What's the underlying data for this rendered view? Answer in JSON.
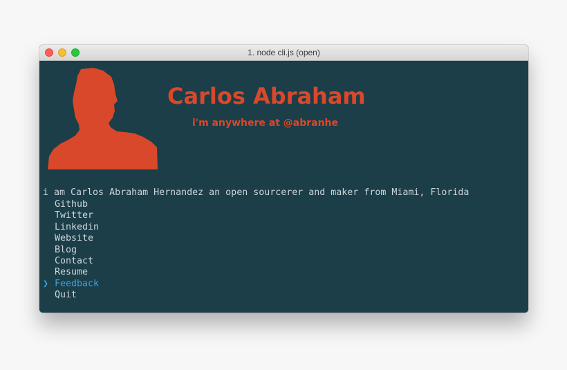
{
  "window": {
    "title": "1. node cli.js (open)"
  },
  "profile": {
    "name": "Carlos Abraham",
    "handle": "i'm anywhere at @abranhe",
    "bio": "i am Carlos Abraham Hernandez an open sourcerer and maker from Miami, Florida",
    "avatar_color": "#d9482a"
  },
  "menu": {
    "pointer": "❯",
    "selected_index": 7,
    "items": [
      {
        "label": "Github"
      },
      {
        "label": "Twitter"
      },
      {
        "label": "Linkedin"
      },
      {
        "label": "Website"
      },
      {
        "label": "Blog"
      },
      {
        "label": "Contact"
      },
      {
        "label": "Resume"
      },
      {
        "label": "Feedback"
      },
      {
        "label": "Quit"
      }
    ]
  },
  "colors": {
    "terminal_bg": "#1b3e49",
    "accent": "#d9482a",
    "selection": "#3fa3dc",
    "text": "#cdd6d9"
  }
}
